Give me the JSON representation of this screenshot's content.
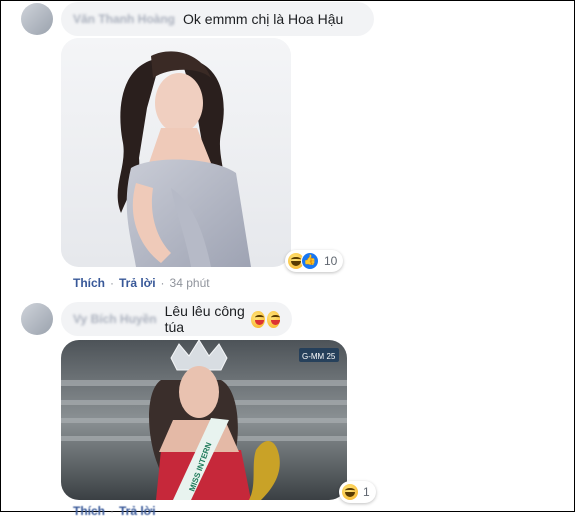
{
  "comments": [
    {
      "author": "Văn Thanh Hoàng",
      "text": "Ok emmm chị là Hoa Hậu",
      "image_alt": "portrait-photo",
      "reaction_count": "10",
      "actions": {
        "like": "Thích",
        "reply": "Trả lời",
        "time": "34 phút"
      }
    },
    {
      "author": "Vy Bích Huyền",
      "text": "Lêu lêu công túa",
      "image_alt": "crowning-photo",
      "reaction_count": "1",
      "actions": {
        "like": "Thích",
        "reply": "Trả lời",
        "time": ""
      },
      "tv_logo": "G-MM 25"
    }
  ]
}
